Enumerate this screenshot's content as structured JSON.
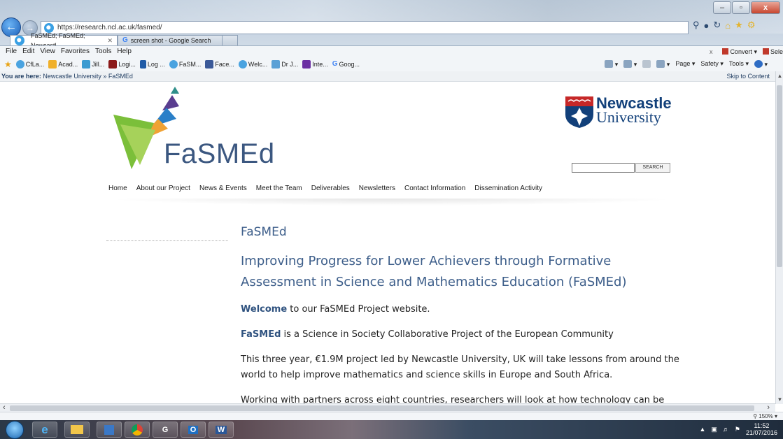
{
  "browser": {
    "url": "https://research.ncl.ac.uk/fasmed/",
    "tabs": [
      {
        "label": "FaSMEd; FaSMEd; Newcastl...",
        "active": true
      },
      {
        "label": "screen shot - Google Search",
        "active": false
      }
    ],
    "menu": [
      "File",
      "Edit",
      "View",
      "Favorites",
      "Tools",
      "Help"
    ],
    "menu_right": {
      "close": "x",
      "convert": "Convert",
      "select": "Sele"
    },
    "favorites": [
      "CfLa...",
      "Acad...",
      "Jill...",
      "Logi...",
      "Log ...",
      "FaSM...",
      "Face...",
      "Welc...",
      "Dr J...",
      "Inte...",
      "Goog..."
    ],
    "commands": [
      "Page",
      "Safety",
      "Tools"
    ],
    "zoom": "150%",
    "window_buttons": {
      "minimize": "–",
      "maximize": "▫",
      "close": "x"
    }
  },
  "page": {
    "breadcrumb_prefix": "You are here:",
    "breadcrumb_trail": "Newcastle University » FaSMEd",
    "skip_link": "Skip to Content",
    "logo_word": "FaSMEd",
    "university_line1": "Newcastle",
    "university_line2": "University",
    "search_button": "SEARCH",
    "nav": [
      "Home",
      "About our Project",
      "News & Events",
      "Meet the Team",
      "Deliverables",
      "Newsletters",
      "Contact Information",
      "Dissemination Activity"
    ],
    "title": "FaSMEd",
    "subtitle": "Improving Progress for Lower Achievers through Formative Assessment in Science and Mathematics Education (FaSMEd)",
    "welcome_strong": "Welcome",
    "welcome_rest": " to our FaSMEd Project website.",
    "about_strong": "FaSMEd",
    "about_rest": " is a Science in Society Collaborative Project of the European Community",
    "para3": "This three year, €1.9M project led by Newcastle University, UK will take lessons from around the world to help improve mathematics and science skills in Europe and South Africa.",
    "para4": "Working with partners across eight countries, researchers will look at how technology can be"
  },
  "taskbar": {
    "time": "11:52",
    "date": "21/07/2016",
    "apps": [
      "e",
      "",
      "",
      "",
      "G",
      "O",
      "W"
    ]
  }
}
